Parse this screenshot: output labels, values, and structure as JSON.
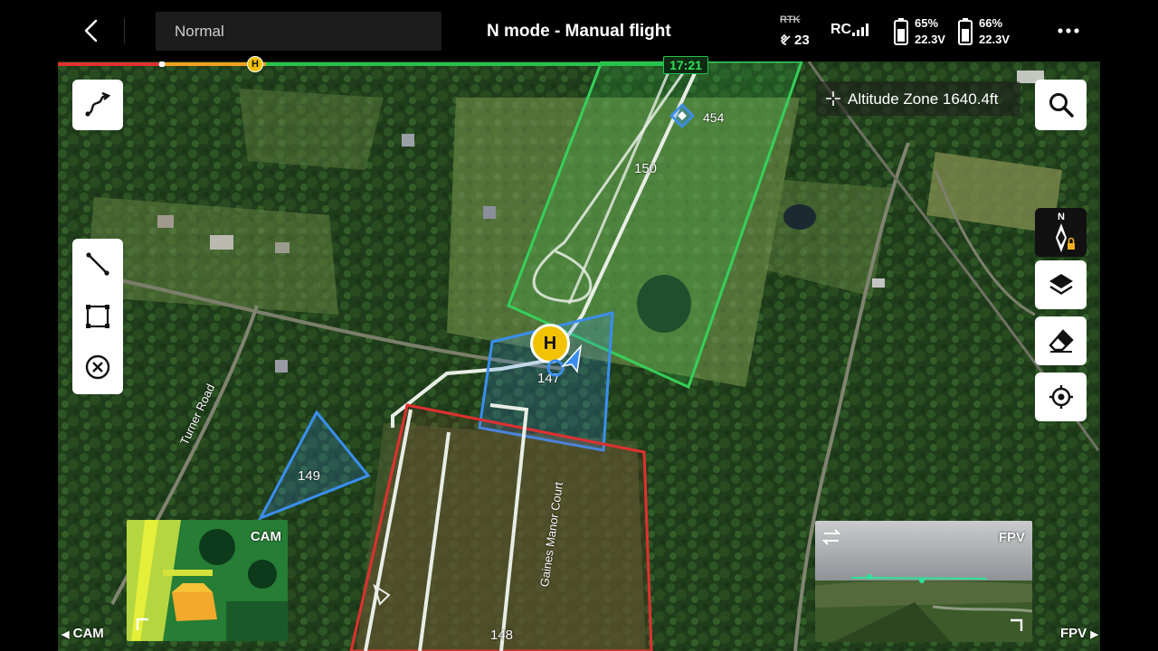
{
  "topbar": {
    "mode_selector": "Normal",
    "flight_mode": "N mode - Manual flight",
    "rtk_label": "RTK",
    "satellite_count": "23",
    "rc_label": "RC",
    "battery_1": {
      "percent": "65%",
      "voltage": "22.3V"
    },
    "battery_2": {
      "percent": "66%",
      "voltage": "22.3V"
    }
  },
  "timeline": {
    "elapsed_time": "17:21",
    "home_marker": "H",
    "progress_fraction": 0.58
  },
  "map": {
    "altitude_zone": "Altitude Zone 1640.4ft",
    "home_point": "H",
    "compass_north": "N",
    "zone_labels": [
      "454",
      "150",
      "147",
      "149",
      "148"
    ],
    "road_labels": [
      "Turner Road",
      "Gaines Manor Court"
    ]
  },
  "thumbnails": {
    "cam_label": "CAM",
    "fpv_label": "FPV",
    "bottom_left": "CAM",
    "bottom_right": "FPV"
  },
  "colors": {
    "green_zone": "#35d05a",
    "red_zone": "#e03030",
    "blue_zone": "#3a8ef0",
    "progress_red": "#e03030",
    "progress_orange": "#f0a020",
    "progress_green": "#27c24c",
    "home_yellow": "#f2c200"
  },
  "icons": {
    "back": "chevron-left-icon",
    "more": "more-horizontal-icon",
    "route": "route-icon",
    "line_tool": "line-draw-icon",
    "area_tool": "area-draw-icon",
    "clear_tool": "close-circle-icon",
    "search": "search-icon",
    "compass": "compass-north-icon",
    "layers": "layers-icon",
    "eraser": "eraser-icon",
    "locate": "locate-icon",
    "swap": "swap-icon"
  }
}
